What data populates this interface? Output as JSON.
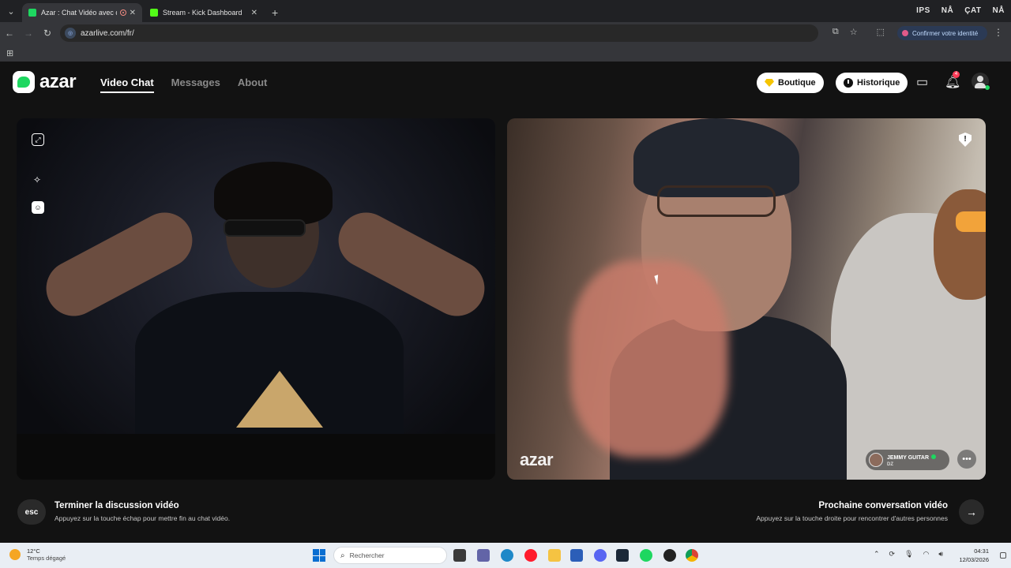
{
  "browser": {
    "tabs": [
      {
        "title": "Azar : Chat Vidéo avec de",
        "active": true,
        "favicon_color": "#1ed760"
      },
      {
        "title": "Stream - Kick Dashboard",
        "active": false,
        "favicon_color": "#53fc18"
      }
    ],
    "new_tab_symbol": "+",
    "url": "azarlive.com/fr/",
    "identity_button": "Confirmer votre identité",
    "tray_labels": [
      "IPS",
      "NÅ",
      "ÇAT",
      "NÅ"
    ]
  },
  "app": {
    "logo_text": "azar",
    "nav": [
      {
        "label": "Video Chat",
        "active": true
      },
      {
        "label": "Messages",
        "active": false
      },
      {
        "label": "About",
        "active": false
      }
    ],
    "shop_label": "Boutique",
    "history_label": "Historique",
    "notification_count": "4",
    "accent_color": "#1ed760"
  },
  "video": {
    "watermark": "azar",
    "peer_name": "JEMMY GUITAR",
    "peer_country": "DZ"
  },
  "controls": {
    "end_key": "esc",
    "end_title": "Terminer la discussion vidéo",
    "end_subtitle": "Appuyez sur la touche échap pour mettre fin au chat vidéo.",
    "next_title": "Prochaine conversation vidéo",
    "next_subtitle": "Appuyez sur la touche droite pour rencontrer d'autres personnes"
  },
  "taskbar": {
    "temperature": "12°C",
    "weather_condition": "Temps dégagé",
    "search_placeholder": "Rechercher",
    "time": "04:31",
    "date": "12/03/2026"
  }
}
